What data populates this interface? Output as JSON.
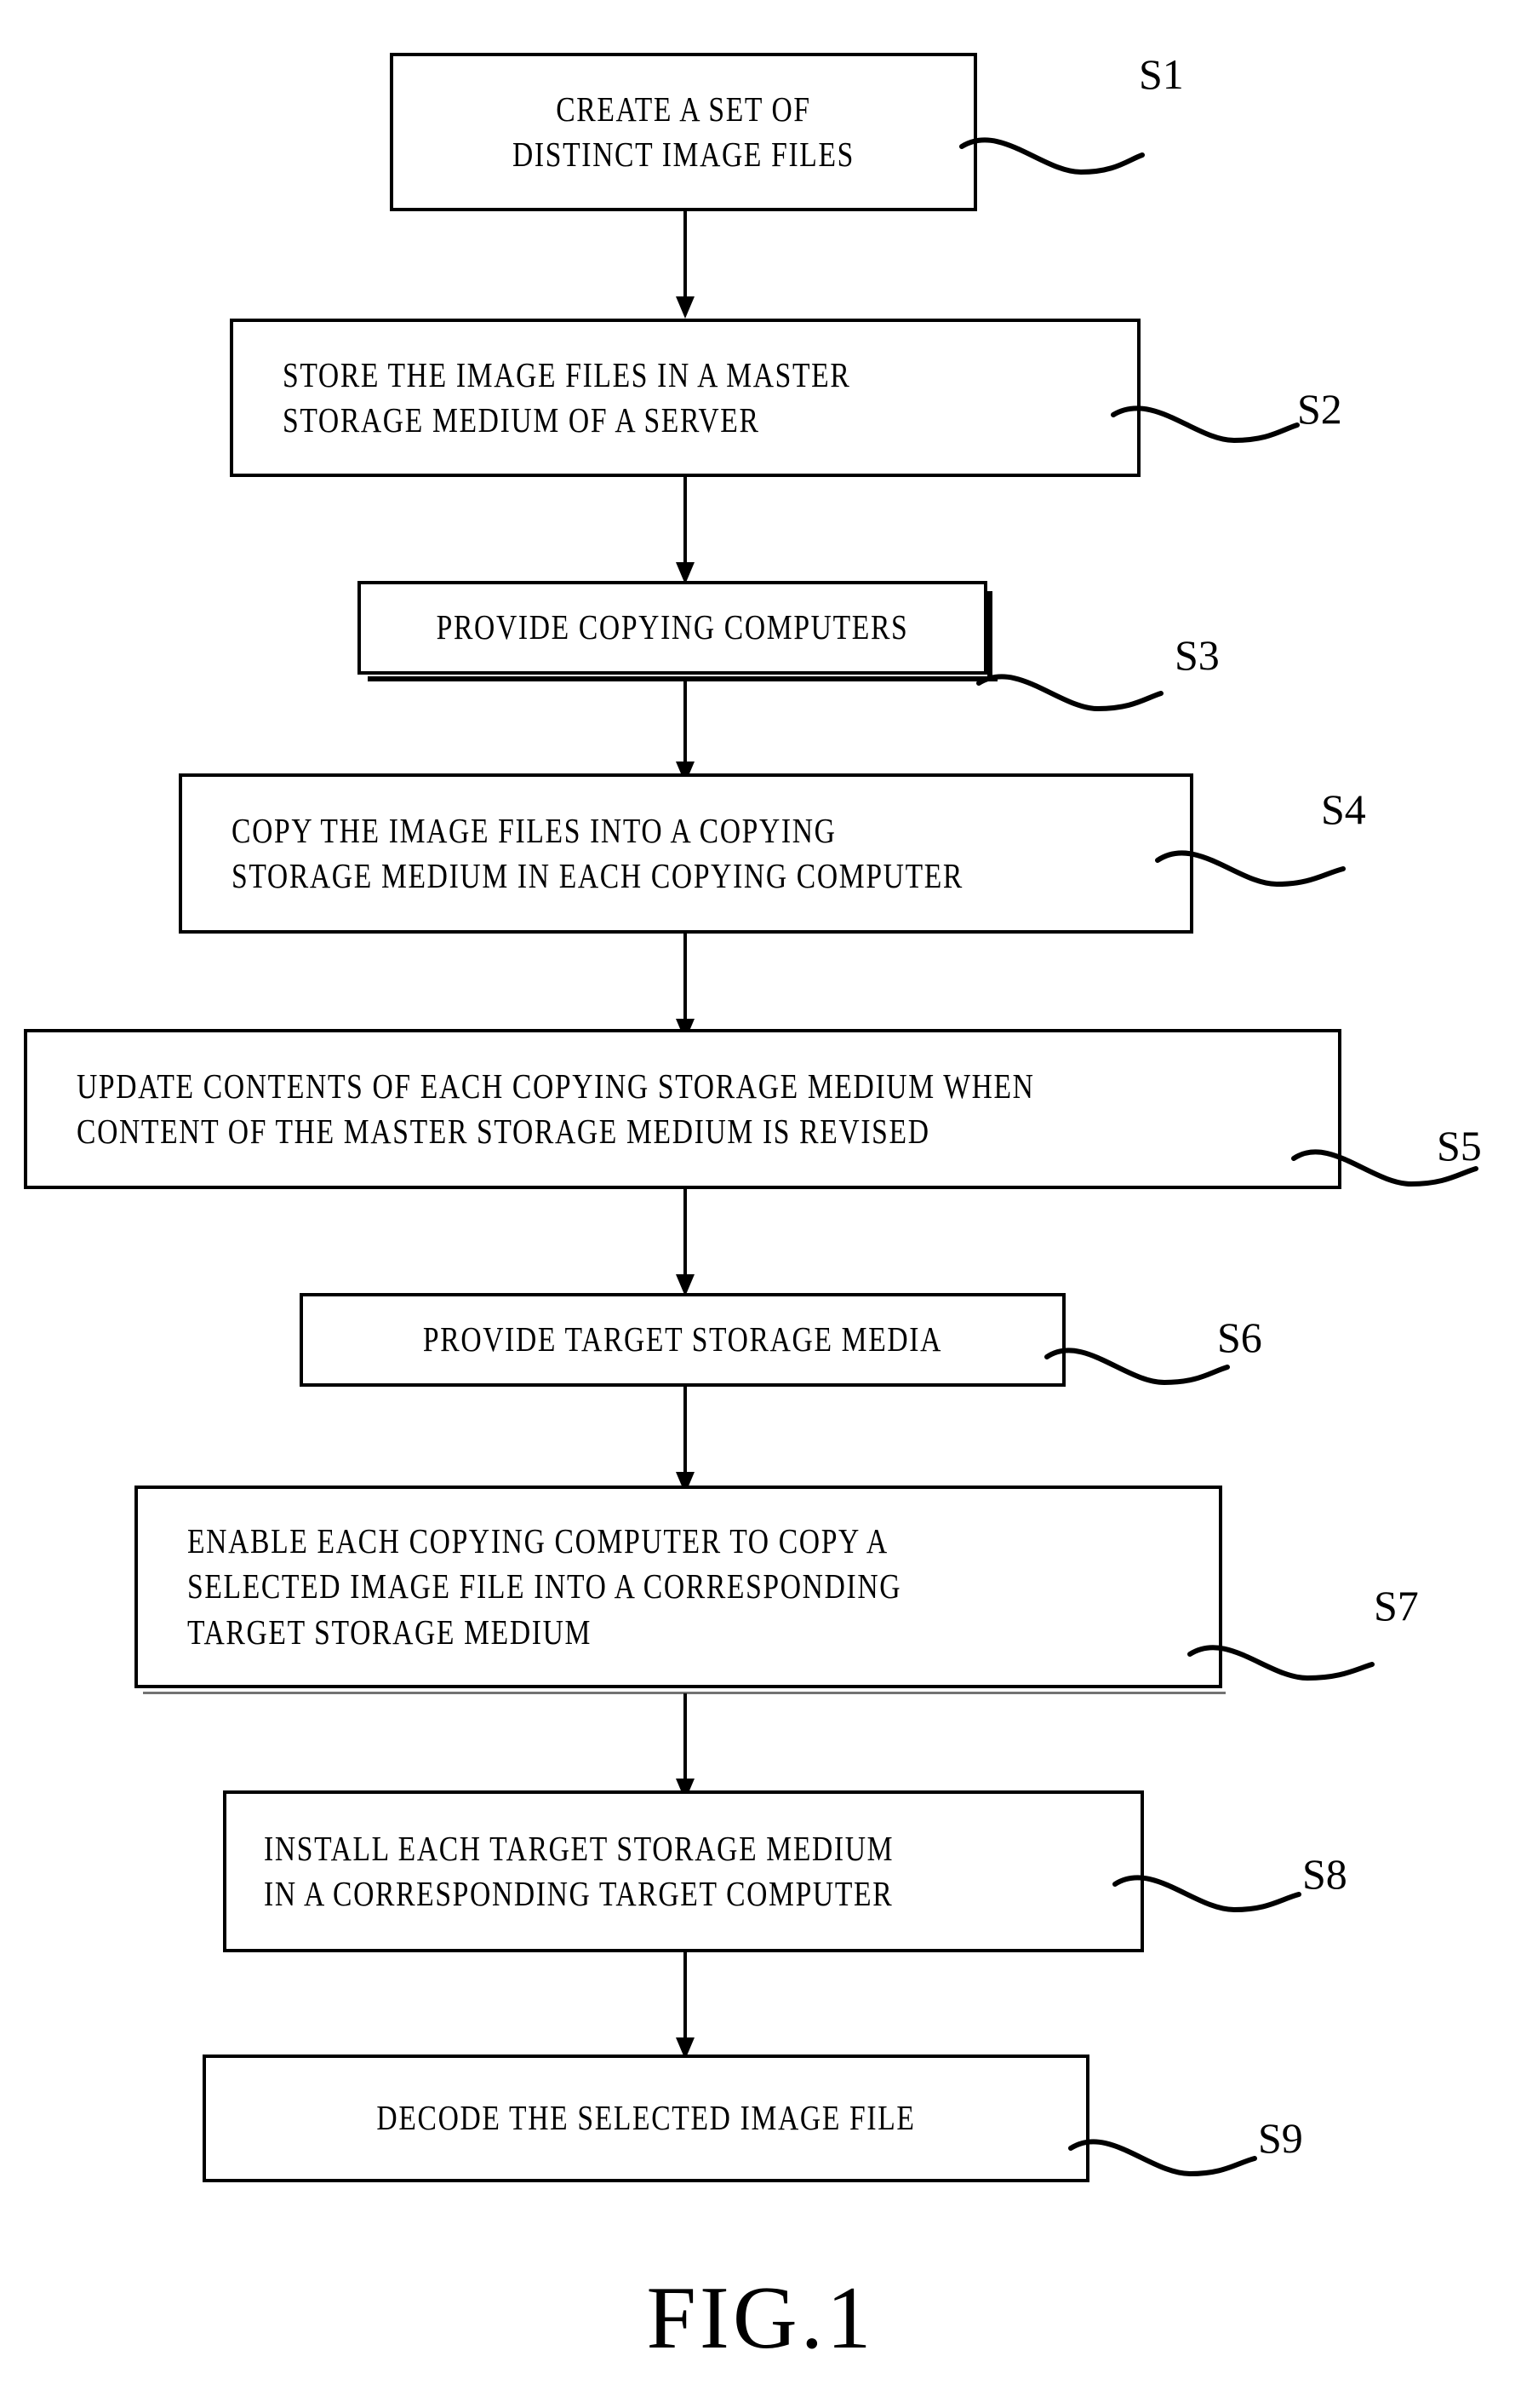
{
  "figure": {
    "caption": "FIG.1",
    "type": "process-flowchart"
  },
  "steps": [
    {
      "id": "S1",
      "label": "S1",
      "lines": [
        "CREATE A SET OF",
        "DISTINCT IMAGE FILES"
      ],
      "align": "center"
    },
    {
      "id": "S2",
      "label": "S2",
      "lines": [
        "STORE THE IMAGE FILES IN A MASTER",
        "STORAGE MEDIUM OF A SERVER"
      ],
      "align": "left"
    },
    {
      "id": "S3",
      "label": "S3",
      "lines": [
        "PROVIDE COPYING COMPUTERS"
      ],
      "align": "center"
    },
    {
      "id": "S4",
      "label": "S4",
      "lines": [
        "COPY THE IMAGE FILES INTO A COPYING",
        "STORAGE MEDIUM IN EACH COPYING COMPUTER"
      ],
      "align": "left"
    },
    {
      "id": "S5",
      "label": "S5",
      "lines": [
        "UPDATE CONTENTS OF EACH COPYING STORAGE MEDIUM WHEN",
        "CONTENT OF THE MASTER STORAGE MEDIUM IS REVISED"
      ],
      "align": "left"
    },
    {
      "id": "S6",
      "label": "S6",
      "lines": [
        "PROVIDE TARGET STORAGE MEDIA"
      ],
      "align": "center"
    },
    {
      "id": "S7",
      "label": "S7",
      "lines": [
        "ENABLE EACH COPYING COMPUTER TO COPY A",
        "SELECTED IMAGE FILE INTO A CORRESPONDING",
        "TARGET STORAGE MEDIUM"
      ],
      "align": "left"
    },
    {
      "id": "S8",
      "label": "S8",
      "lines": [
        "INSTALL EACH TARGET STORAGE MEDIUM",
        "IN A CORRESPONDING TARGET COMPUTER"
      ],
      "align": "left"
    },
    {
      "id": "S9",
      "label": "S9",
      "lines": [
        "DECODE THE SELECTED IMAGE FILE"
      ],
      "align": "center"
    }
  ],
  "colors": {
    "ink": "#000000",
    "paper": "#ffffff"
  }
}
